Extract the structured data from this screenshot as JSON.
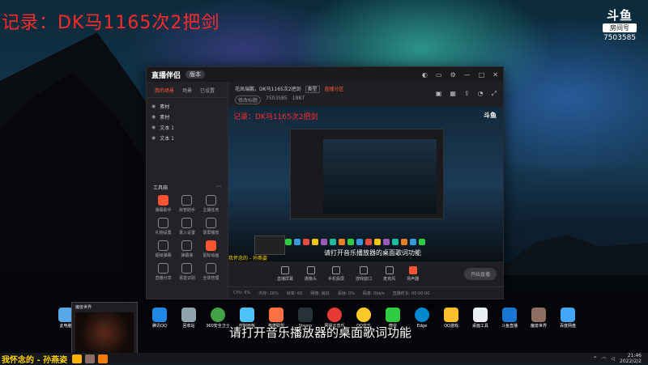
{
  "overlay_title": "记录：DK马1165次2把剑",
  "douyu": {
    "logo": "斗鱼",
    "room_label": "房间号",
    "room_id": "7503585"
  },
  "app": {
    "brand": "直播伴侣",
    "version": "版本",
    "left_tabs": [
      "我的场景",
      "场景",
      "已设置"
    ],
    "sources": [
      "素材",
      "素材",
      "文本 1",
      "文本 1"
    ],
    "tools_header": "工具箱",
    "tools": [
      "弹幕助手",
      "房管助手",
      "主播任务",
      "礼物设置",
      "录入设置",
      "录屏播放",
      "超级弹幕",
      "弹幕库",
      "鼠标动画",
      "直播分享",
      "语音识别",
      "全体管理"
    ],
    "info": {
      "title": "花凤瑞鹏，DK马1165次2把剑",
      "tag": "类型",
      "edit": "修改标题",
      "rid": "7503585",
      "fans": "1887",
      "category": "直播分区"
    },
    "preview_title": "记录：DK马1165次2把剑",
    "preview_logo": "斗鱼",
    "preview_subtitle": "请打开音乐播放器的桌面歌词功能",
    "preview_name": "我怀念的 - 孙燕姿",
    "controls": [
      "直播屏幕",
      "摄像头",
      "手机投屏",
      "游戏窗口",
      "麦克风",
      "扬声器"
    ],
    "start_button": "开始直播",
    "status": [
      "CPU: 6%",
      "内存: 26%",
      "帧率: 60",
      "网络: 良好",
      "丢帧: 0%",
      "码率: 0kb/s",
      "直播时长: 00:00:00"
    ]
  },
  "desktop_icons": [
    "此电脑",
    "腾讯QQ",
    "回收站",
    "360安全卫士",
    "控制面板",
    "英雄联盟",
    "Steam",
    "网易云音乐",
    "QQ音乐",
    "微信",
    "Edge",
    "QQ游戏",
    "桌面工具",
    "斗鱼直播",
    "魔兽世界",
    "百度网盘"
  ],
  "thumb_window_title": "魔兽世界",
  "subtitle": "请打开音乐播放器的桌面歌词功能",
  "now_playing": "我怀念的 - 孙燕姿",
  "clock": {
    "time": "21:46",
    "date": "2022/2/2"
  },
  "colors": {
    "accent": "#ff5533",
    "title_red": "#ff2b2b",
    "lyric_yellow": "#ffd400"
  }
}
